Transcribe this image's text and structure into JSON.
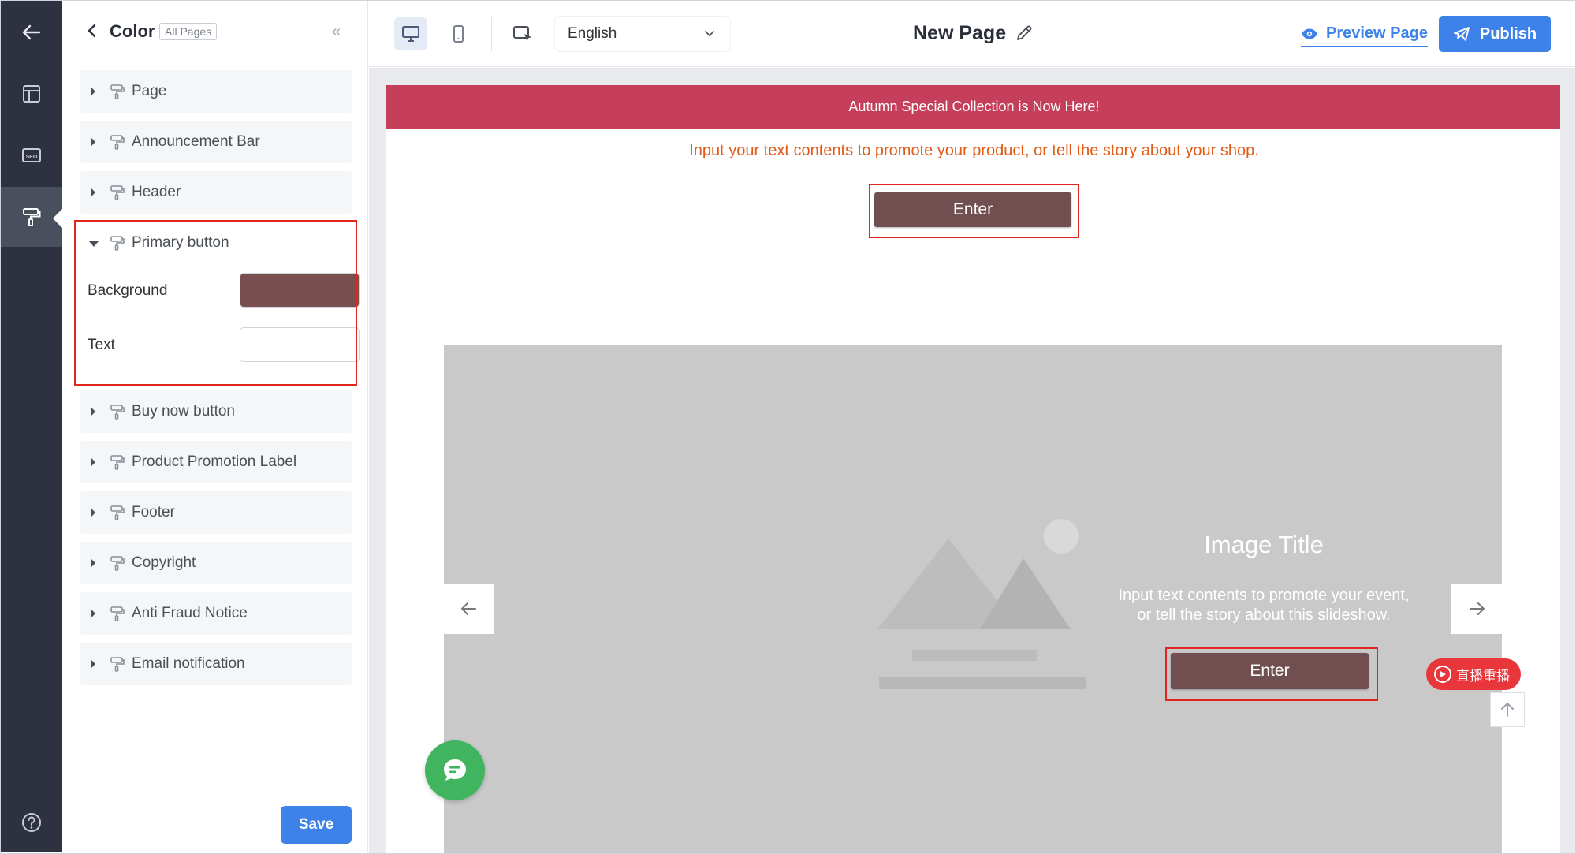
{
  "panel": {
    "title": "Color",
    "badge": "All Pages",
    "sections": [
      {
        "label": "Page"
      },
      {
        "label": "Announcement Bar"
      },
      {
        "label": "Header"
      },
      {
        "label": "Primary button"
      },
      {
        "label": "Buy now button"
      },
      {
        "label": "Product Promotion Label"
      },
      {
        "label": "Footer"
      },
      {
        "label": "Copyright"
      },
      {
        "label": "Anti Fraud Notice"
      },
      {
        "label": "Email notification"
      }
    ],
    "primary_button": {
      "background_label": "Background",
      "background_color": "#7a4f50",
      "text_label": "Text",
      "text_color": "#ffffff"
    },
    "save_label": "Save"
  },
  "topbar": {
    "language": "English",
    "page_title": "New Page",
    "preview_label": "Preview Page",
    "publish_label": "Publish"
  },
  "preview": {
    "announcement": "Autumn Special Collection is Now Here!",
    "promo_text": "Input your text contents to promote your product, or tell the story about your shop.",
    "enter_label": "Enter",
    "slide": {
      "title": "Image Title",
      "desc_line1": "Input text contents to promote your event,",
      "desc_line2": "or tell the story about this slideshow.",
      "enter_label": "Enter"
    },
    "live_badge": "直播重播"
  },
  "colors": {
    "accent": "#3d82e8",
    "announcement_bg": "#c53f5b",
    "button_bg": "#714f51",
    "promo_text": "#e25a15",
    "highlight": "#e1261c"
  }
}
